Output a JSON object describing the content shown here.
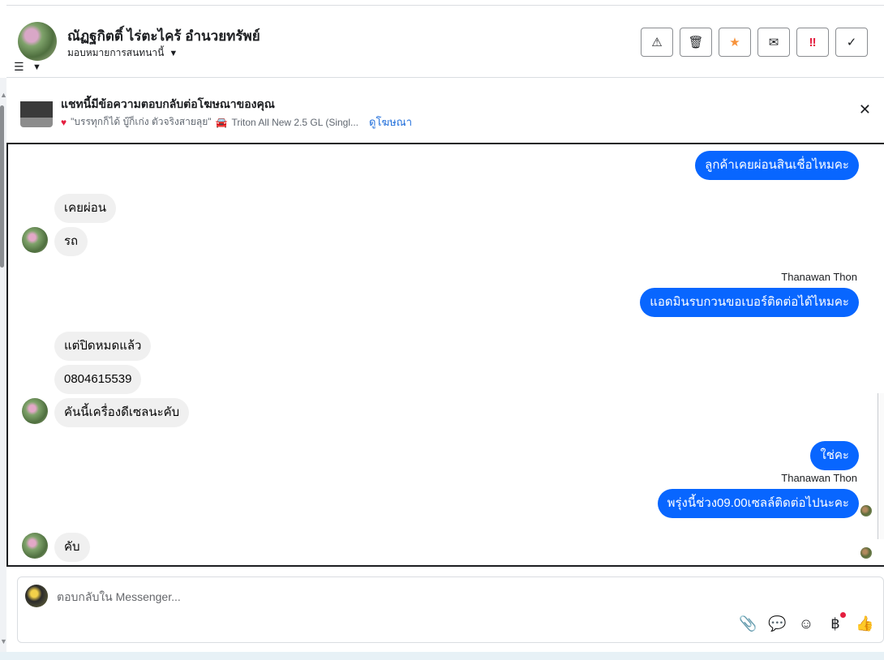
{
  "header": {
    "contact_name": "ณัฏฐกิตติ์ ไร่ตะไคร้ อำนวยทรัพย์",
    "assign_label": "มอบหมายการสนทนานี้",
    "filter_icon": "sliders-icon",
    "actions": [
      {
        "name": "warning-button",
        "icon": "warning-icon",
        "glyph": "⚠"
      },
      {
        "name": "delete-button",
        "icon": "trash-icon",
        "glyph": "🗑"
      },
      {
        "name": "star-button",
        "icon": "star-icon",
        "glyph": "★"
      },
      {
        "name": "mark-unread-button",
        "icon": "envelope-open-icon",
        "glyph": "✉"
      },
      {
        "name": "urgent-button",
        "icon": "double-exclamation-icon",
        "glyph": "‼"
      },
      {
        "name": "done-button",
        "icon": "check-icon",
        "glyph": "✓"
      }
    ]
  },
  "ad_banner": {
    "title": "แชทนี้มีข้อความตอบกลับต่อโฆษณาของคุณ",
    "quote": "\"บรรทุกก็ได้ บู๊ก็เก่ง ตัวจริงสายลุย\"",
    "product": "Triton All New 2.5 GL (Singl...",
    "link": "ดูโฆษณา",
    "close_icon": "close-icon"
  },
  "messages": [
    {
      "id": "m1",
      "direction": "out",
      "text": "ลูกค้าเคยผ่อนสินเชื่อไหมคะ"
    },
    {
      "id": "m2",
      "direction": "in",
      "text": "เคยผ่อน"
    },
    {
      "id": "m3",
      "direction": "in",
      "text": "รถ"
    },
    {
      "id": "s1",
      "sender": "Thanawan Thon"
    },
    {
      "id": "m4",
      "direction": "out",
      "text": "แอดมินรบกวนขอเบอร์ติดต่อได้ไหมคะ"
    },
    {
      "id": "m5",
      "direction": "in",
      "text": "แต่ปิดหมดแล้ว"
    },
    {
      "id": "m6",
      "direction": "in",
      "text": "0804615539"
    },
    {
      "id": "m7",
      "direction": "in",
      "text": "คันนี้เครื่องดีเซลนะคับ"
    },
    {
      "id": "m8",
      "direction": "out",
      "text": "ใช่คะ"
    },
    {
      "id": "s2",
      "sender": "Thanawan Thon"
    },
    {
      "id": "m9",
      "direction": "out",
      "text": "พรุ่งนี้ช่วง09.00เซลล์ติดต่อไปนะคะ"
    },
    {
      "id": "m10",
      "direction": "in",
      "text": "คับ"
    }
  ],
  "composer": {
    "placeholder": "ตอบกลับใน Messenger...",
    "icons": [
      "paperclip-icon",
      "saved-reply-icon",
      "emoji-icon",
      "baht-payment-icon",
      "thumbs-up-icon"
    ]
  }
}
